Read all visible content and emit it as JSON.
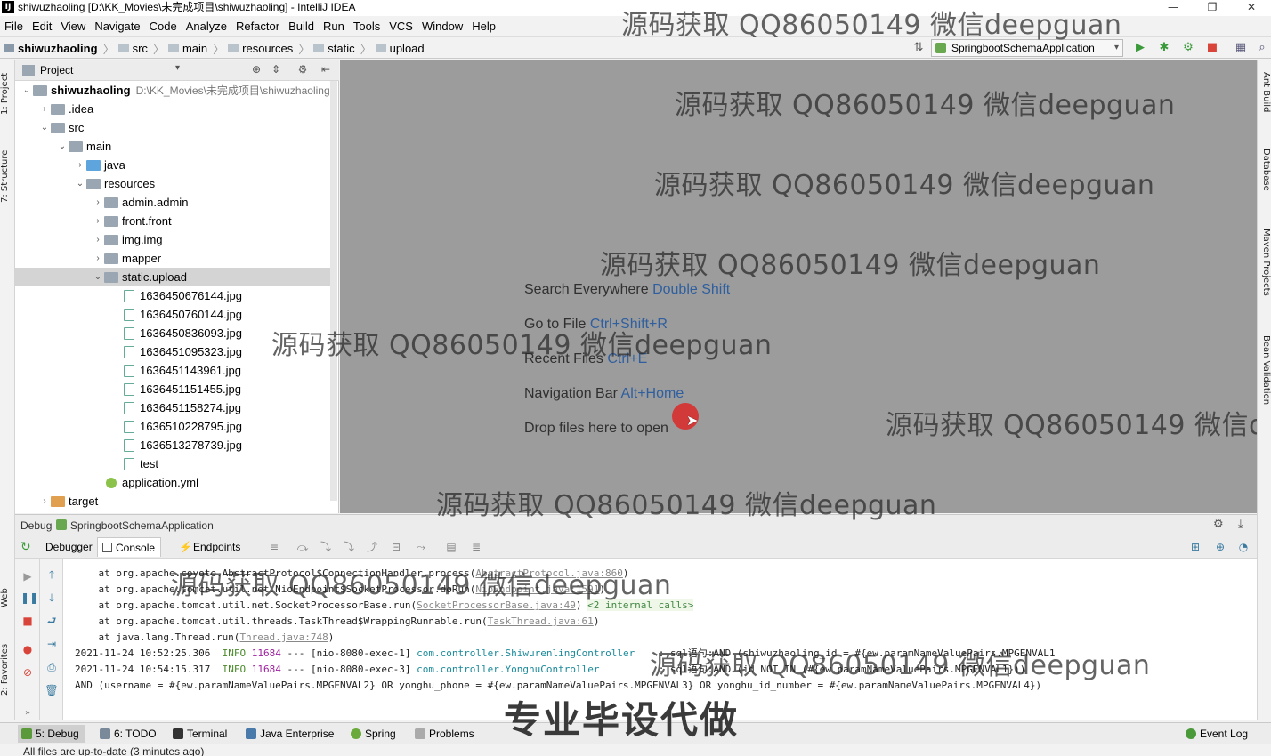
{
  "window": {
    "title": "shiwuzhaoling [D:\\KK_Movies\\未完成项目\\shiwuzhaoling] - IntelliJ IDEA",
    "minimize": "—",
    "restore": "❐",
    "close": "✕"
  },
  "menu": [
    "File",
    "Edit",
    "View",
    "Navigate",
    "Code",
    "Analyze",
    "Refactor",
    "Build",
    "Run",
    "Tools",
    "VCS",
    "Window",
    "Help"
  ],
  "breadcrumb": [
    "shiwuzhaoling",
    "src",
    "main",
    "resources",
    "static",
    "upload"
  ],
  "run_config": "SpringbootSchemaApplication",
  "left_strip": [
    "1: Project",
    "7: Structure",
    "Web",
    "2: Favorites"
  ],
  "right_strip": [
    "Ant Build",
    "Database",
    "Maven Projects",
    "Bean Validation"
  ],
  "project": {
    "header": "Project",
    "tree": [
      {
        "label": "shiwuzhaoling",
        "path": "D:\\KK_Movies\\未完成项目\\shiwuzhaoling",
        "arrow": "⌄"
      },
      {
        "label": ".idea",
        "arrow": "›"
      },
      {
        "label": "src",
        "arrow": "⌄"
      },
      {
        "label": "main",
        "arrow": "⌄"
      },
      {
        "label": "java",
        "arrow": "›"
      },
      {
        "label": "resources",
        "arrow": "⌄"
      },
      {
        "label": "admin.admin",
        "arrow": "›"
      },
      {
        "label": "front.front",
        "arrow": "›"
      },
      {
        "label": "img.img",
        "arrow": "›"
      },
      {
        "label": "mapper",
        "arrow": "›"
      },
      {
        "label": "static.upload",
        "arrow": "⌄"
      },
      {
        "label": "1636450676144.jpg"
      },
      {
        "label": "1636450760144.jpg"
      },
      {
        "label": "1636450836093.jpg"
      },
      {
        "label": "1636451095323.jpg"
      },
      {
        "label": "1636451143961.jpg"
      },
      {
        "label": "1636451151455.jpg"
      },
      {
        "label": "1636451158274.jpg"
      },
      {
        "label": "1636510228795.jpg"
      },
      {
        "label": "1636513278739.jpg"
      },
      {
        "label": "test"
      },
      {
        "label": "application.yml"
      },
      {
        "label": "target",
        "arrow": "›"
      }
    ]
  },
  "editor_hints": [
    {
      "text": "Search Everywhere",
      "key": "Double Shift"
    },
    {
      "text": "Go to File",
      "key": "Ctrl+Shift+R"
    },
    {
      "text": "Recent Files",
      "key": "Ctrl+E"
    },
    {
      "text": "Navigation Bar",
      "key": "Alt+Home"
    },
    {
      "text": "Drop files here to open",
      "key": ""
    }
  ],
  "debug": {
    "title": "Debug",
    "app": "SpringbootSchemaApplication",
    "tabs": [
      "Debugger",
      "Console",
      "Endpoints"
    ],
    "console": [
      {
        "prefix": "    at org.apache.coyote.AbstractProtocol$ConnectionHandler.process(",
        "link": "AbstractProtocol.java:860",
        "suffix": ")"
      },
      {
        "prefix": "    at org.apache.tomcat.util.net.NioEndpoint$SocketProcessor.doRun(",
        "link": "NioEndpoint.java:1591",
        "suffix": ")"
      },
      {
        "prefix": "    at org.apache.tomcat.util.net.SocketProcessorBase.run(",
        "link": "SocketProcessorBase.java:49",
        "suffix": ") ",
        "extra": "<2 internal calls>"
      },
      {
        "prefix": "    at org.apache.tomcat.util.threads.TaskThread$WrappingRunnable.run(",
        "link": "TaskThread.java:61",
        "suffix": ")"
      },
      {
        "prefix": "    at java.lang.Thread.run(",
        "link": "Thread.java:748",
        "suffix": ")"
      },
      {
        "time": "2021-11-24 10:52:25.306",
        "level": "INFO",
        "pid": "11684",
        "thread": " --- [nio-8080-exec-1] ",
        "cls": "com.controller.ShiwurenlingController",
        "msg": "    : sql语句:AND (shiwuzhaoling_id = #{ew.paramNameValuePairs.MPGENVAL1"
      },
      {
        "time": "2021-11-24 10:54:15.317",
        "level": "INFO",
        "pid": "11684",
        "thread": " --- [nio-8080-exec-3] ",
        "cls": "com.controller.YonghuController",
        "msg": "          : sql语句:AND (id NOT IN (#{ew.paramNameValuePairs.MPGENVAL1}))"
      },
      {
        "plain": "AND (username = #{ew.paramNameValuePairs.MPGENVAL2} OR yonghu_phone = #{ew.paramNameValuePairs.MPGENVAL3} OR yonghu_id_number = #{ew.paramNameValuePairs.MPGENVAL4})"
      }
    ]
  },
  "bottom_tabs": [
    "5: Debug",
    "6: TODO",
    "Terminal",
    "Java Enterprise",
    "Spring",
    "Problems"
  ],
  "event_log": "Event Log",
  "status": "All files are up-to-date (3 minutes ago)",
  "watermark": "源码获取 QQ86050149 微信deepguan",
  "banner": "专业毕设代做"
}
